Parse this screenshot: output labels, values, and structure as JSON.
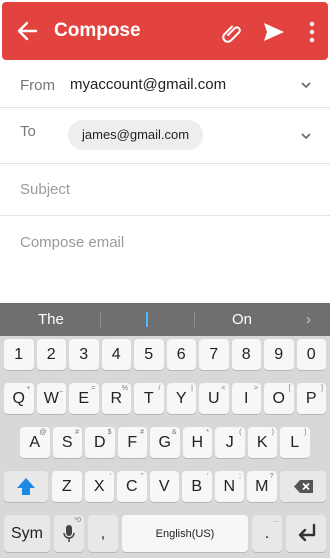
{
  "app_bar": {
    "title": "Compose"
  },
  "from": {
    "label": "From",
    "value": "myaccount@gmail.com"
  },
  "to": {
    "label": "To",
    "chip": "james@gmail.com"
  },
  "subject": {
    "placeholder": "Subject"
  },
  "body": {
    "placeholder": "Compose email"
  },
  "keyboard": {
    "suggestions": [
      "The",
      "On"
    ],
    "row_numbers": [
      "1",
      "2",
      "3",
      "4",
      "5",
      "6",
      "7",
      "8",
      "9",
      "0"
    ],
    "row_top": [
      {
        "k": "Q",
        "s": "+"
      },
      {
        "k": "W",
        "s": "_"
      },
      {
        "k": "E",
        "s": "="
      },
      {
        "k": "R",
        "s": "%"
      },
      {
        "k": "T",
        "s": "/"
      },
      {
        "k": "Y",
        "s": "|"
      },
      {
        "k": "U",
        "s": "<"
      },
      {
        "k": "I",
        "s": ">"
      },
      {
        "k": "O",
        "s": "["
      },
      {
        "k": "P",
        "s": "]"
      }
    ],
    "row_mid": [
      {
        "k": "A",
        "s": "@"
      },
      {
        "k": "S",
        "s": "#"
      },
      {
        "k": "D",
        "s": "$"
      },
      {
        "k": "F",
        "s": "#"
      },
      {
        "k": "G",
        "s": "&"
      },
      {
        "k": "H",
        "s": "*"
      },
      {
        "k": "J",
        "s": "("
      },
      {
        "k": "K",
        "s": ")"
      },
      {
        "k": "L",
        "s": ")"
      }
    ],
    "row_bottom": [
      {
        "k": "Z",
        "s": ""
      },
      {
        "k": "X",
        "s": "'"
      },
      {
        "k": "C",
        "s": "\""
      },
      {
        "k": "V",
        "s": ""
      },
      {
        "k": "B",
        "s": "'"
      },
      {
        "k": "N",
        "s": ";"
      },
      {
        "k": "M",
        "s": "?"
      }
    ],
    "sym_label": "Sym",
    "comma_label": ",",
    "space_label": "English(US)",
    "period_label": ".",
    "mic_sub": "*0",
    "period_sub": "..."
  },
  "colors": {
    "app_bar": "#e2433e",
    "cursor": "#50b8ff",
    "shift": "#1e88e5"
  }
}
